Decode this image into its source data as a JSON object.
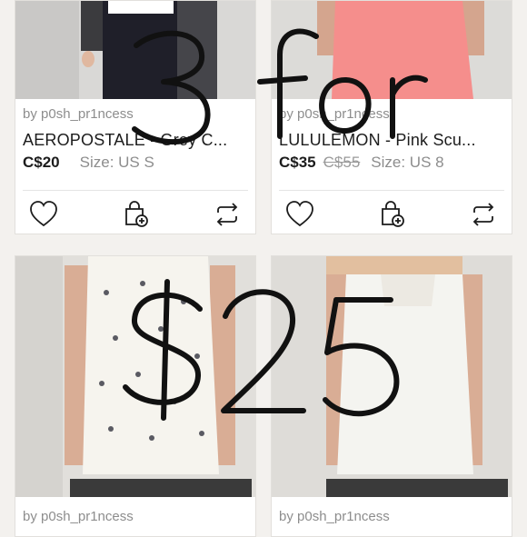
{
  "promo": {
    "line1": "3 for",
    "line2": "$25"
  },
  "listings": [
    {
      "seller": "by p0sh_pr1ncess",
      "title": "AEROPOSTALE - Grey C...",
      "price": "C$20",
      "original_price": "",
      "size": "Size: US S"
    },
    {
      "seller": "by p0sh_pr1ncess",
      "title": "LULULEMON - Pink Scu...",
      "price": "C$35",
      "original_price": "C$55",
      "size": "Size: US 8"
    },
    {
      "seller": "by p0sh_pr1ncess"
    },
    {
      "seller": "by p0sh_pr1ncess"
    }
  ],
  "icons": {
    "like": "heart-icon",
    "bundle": "bundle-bag-plus-icon",
    "share": "share-arrows-icon"
  },
  "colors": {
    "page_bg": "#f3f1ee",
    "card_bg": "#ffffff",
    "text": "#1c1c1c",
    "muted": "#8d8d8d"
  }
}
